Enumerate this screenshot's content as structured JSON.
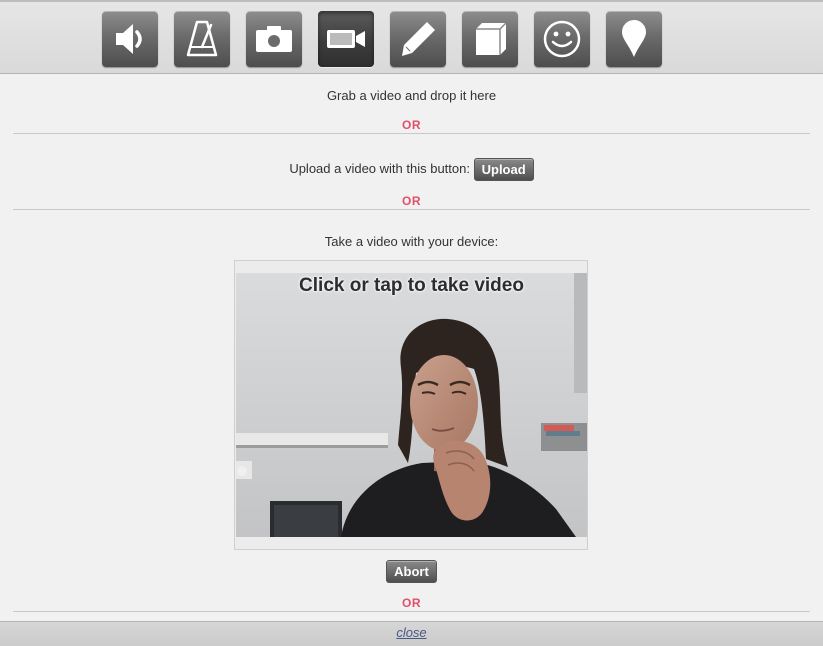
{
  "toolbar": {
    "tools": [
      {
        "icon": "speaker-icon",
        "active": false
      },
      {
        "icon": "metronome-icon",
        "active": false
      },
      {
        "icon": "camera-icon",
        "active": false
      },
      {
        "icon": "video-camera-icon",
        "active": true
      },
      {
        "icon": "pencil-icon",
        "active": false
      },
      {
        "icon": "cube-icon",
        "active": false
      },
      {
        "icon": "smiley-icon",
        "active": false
      },
      {
        "icon": "map-pin-icon",
        "active": false
      }
    ]
  },
  "drop": {
    "text": "Grab a video and drop it here"
  },
  "or_label": "OR",
  "upload": {
    "text": "Upload a video with this button:",
    "button_label": "Upload"
  },
  "capture": {
    "text": "Take a video with your device:",
    "video_caption": "Click or tap to take video",
    "abort_label": "Abort"
  },
  "footer": {
    "close_label": "close"
  }
}
